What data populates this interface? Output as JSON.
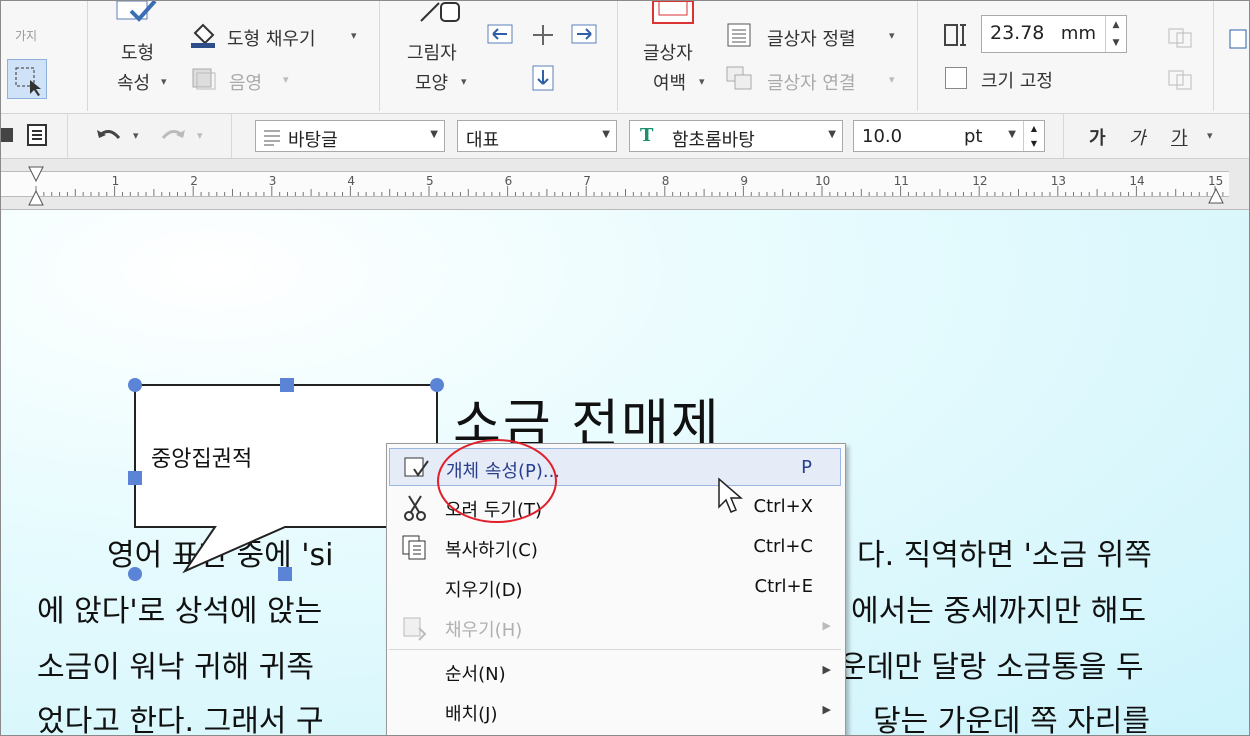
{
  "ribbon": {
    "shape_props": {
      "line1": "도형",
      "line2": "속성"
    },
    "shape_fill": "도형 채우기",
    "shadow": "음영",
    "picture_shape": {
      "line1": "그림자",
      "line2": "모양"
    },
    "textbox_margin": {
      "line1": "글상자",
      "line2": "여백"
    },
    "text_align": "글상자 정렬",
    "text_link": "글상자 연결",
    "width_value": "23.78",
    "width_unit": "mm",
    "fix_size": "크기 고정",
    "small_label": "가지"
  },
  "toolbar2": {
    "style": "바탕글",
    "style2": "대표",
    "font": "함초롬바탕",
    "size_value": "10.0",
    "size_unit": "pt",
    "bold": "가",
    "italic": "가",
    "underline": "가"
  },
  "ruler": {
    "numbers": [
      "1",
      "2",
      "3",
      "4",
      "5",
      "6",
      "7",
      "8",
      "9",
      "10",
      "11",
      "12",
      "13",
      "14",
      "15"
    ]
  },
  "document": {
    "title": "소금 전매제",
    "bubble_text": "중앙집권적",
    "lines": [
      {
        "a": "영어 표현 중에 'si",
        "b": "다. 직역하면 '소금 위쪽"
      },
      {
        "a": "에 앉다'로 상석에 앉는",
        "b": "에서는 중세까지만 해도"
      },
      {
        "a": "소금이 워낙 귀해 귀족",
        "b": "운데만 달랑 소금통을 두"
      },
      {
        "a": "었다고 한다. 그래서 구",
        "b": "닿는 가운데 쪽 자리를"
      }
    ]
  },
  "context_menu": {
    "items": [
      {
        "label": "개체 속성(P)...",
        "shortcut": "P"
      },
      {
        "label": "오려 두기(T)",
        "shortcut": "Ctrl+X"
      },
      {
        "label": "복사하기(C)",
        "shortcut": "Ctrl+C"
      },
      {
        "label": "지우기(D)",
        "shortcut": "Ctrl+E"
      },
      {
        "label": "채우기(H)",
        "shortcut": ""
      },
      {
        "label": "순서(N)",
        "shortcut": ""
      },
      {
        "label": "배치(J)",
        "shortcut": ""
      }
    ]
  },
  "colors": {
    "highlight_circle": "#e0202a",
    "doc_bg": "#ccf3fb",
    "menu_highlight": "#e5ecf8"
  }
}
